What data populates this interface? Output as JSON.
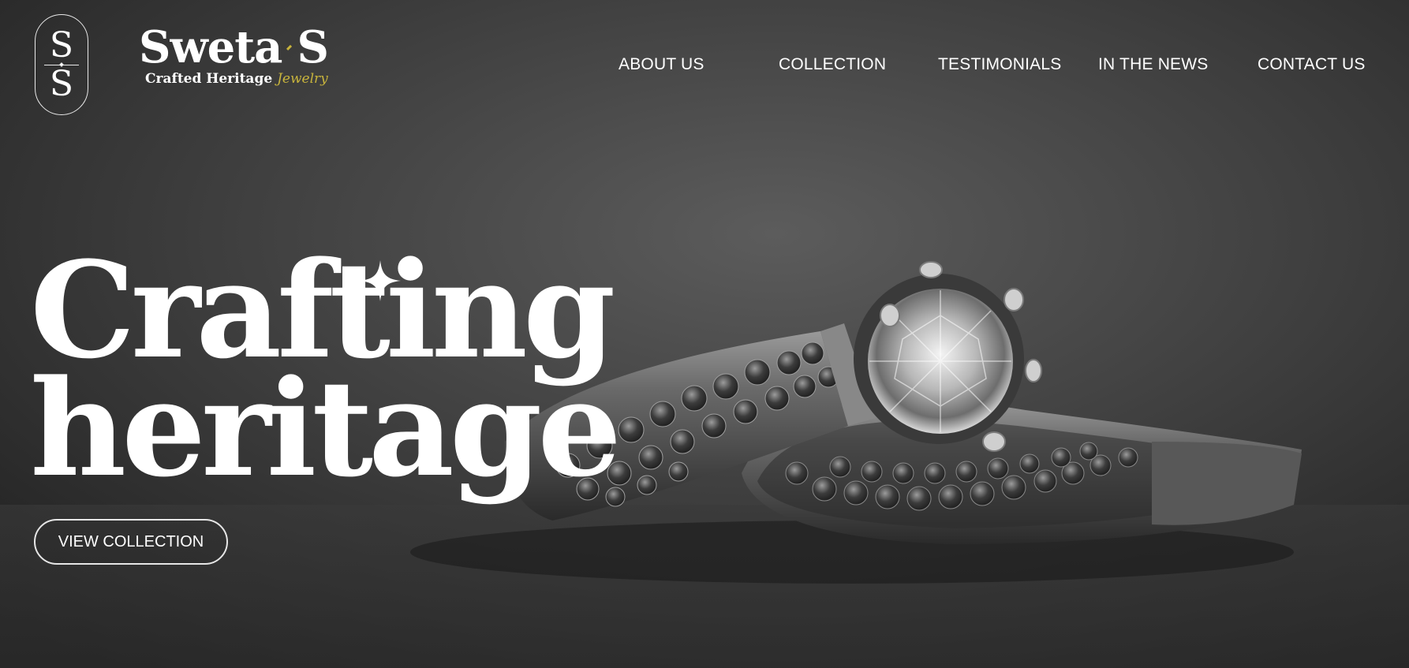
{
  "logo": {
    "mark_top": "S",
    "mark_bottom": "S",
    "brand_first": "Sweta",
    "brand_second": "S",
    "tagline_main": "Crafted Heritage",
    "tagline_accent": "Jewelry",
    "accent_color": "#c8b43c"
  },
  "nav": {
    "items": [
      {
        "label": "ABOUT US"
      },
      {
        "label": "COLLECTION"
      },
      {
        "label": "TESTIMONIALS"
      },
      {
        "label": "IN THE NEWS"
      },
      {
        "label": "CONTACT US"
      }
    ]
  },
  "hero": {
    "headline_line1": "Crafting",
    "headline_line2": "heritage",
    "cta_label": "VIEW COLLECTION",
    "sparkle_icon": "sparkle-icon",
    "background_image": "rings-photo"
  }
}
